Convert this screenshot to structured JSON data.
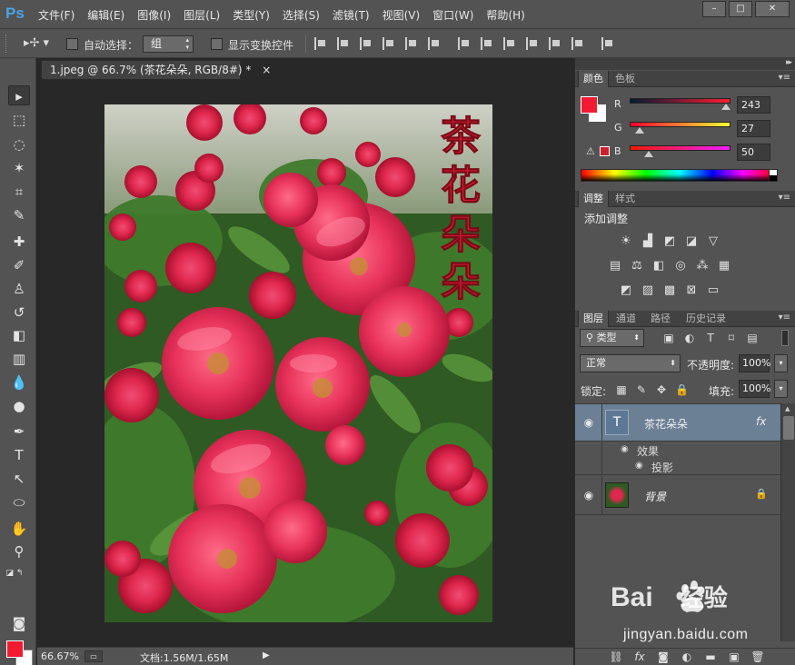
{
  "app": {
    "logo": "Ps",
    "menu": [
      "文件(F)",
      "编辑(E)",
      "图像(I)",
      "图层(L)",
      "类型(Y)",
      "选择(S)",
      "滤镜(T)",
      "视图(V)",
      "窗口(W)",
      "帮助(H)"
    ],
    "window_buttons": [
      "–",
      "□",
      "✕"
    ]
  },
  "options_bar": {
    "auto_select_label": "自动选择：",
    "auto_select_value": "组",
    "show_transform_label": "显示变换控件"
  },
  "document": {
    "tab_title": "1.jpeg @ 66.7% (茶花朵朵, RGB/8#) *",
    "tab_close": "×",
    "artwork_text": "茶花朵朵"
  },
  "status": {
    "zoom": "66.67%",
    "doc_info": "文档:1.56M/1.65M"
  },
  "color_panel": {
    "tabs": [
      "颜色",
      "色板"
    ],
    "channels": [
      {
        "label": "R",
        "value": "243"
      },
      {
        "label": "G",
        "value": "27"
      },
      {
        "label": "B",
        "value": "50"
      }
    ],
    "gamut_warning": "⚠",
    "foreground": "#f31b32",
    "background": "#ffffff"
  },
  "adjust_panel": {
    "tabs": [
      "调整",
      "样式"
    ],
    "title": "添加调整"
  },
  "layers_panel": {
    "tabs": [
      "图层",
      "通道",
      "路径",
      "历史记录"
    ],
    "kind_filter": "类型",
    "blend_mode": "正常",
    "opacity_label": "不透明度:",
    "opacity_value": "100%",
    "lock_label": "锁定:",
    "fill_label": "填充:",
    "fill_value": "100%",
    "text_layer": {
      "name": "茶花朵朵",
      "fx": "fx",
      "effects_label": "效果",
      "effect_item": "投影"
    },
    "background_layer": {
      "name": "背景"
    }
  },
  "watermark": {
    "brand": "Bai",
    "brand_cn": "经验",
    "url": "jingyan.baidu.com"
  },
  "colors": {
    "accent_red": "#f31b32",
    "selection_blue": "#6b7f95",
    "ps_blue": "#4aa3e8"
  }
}
